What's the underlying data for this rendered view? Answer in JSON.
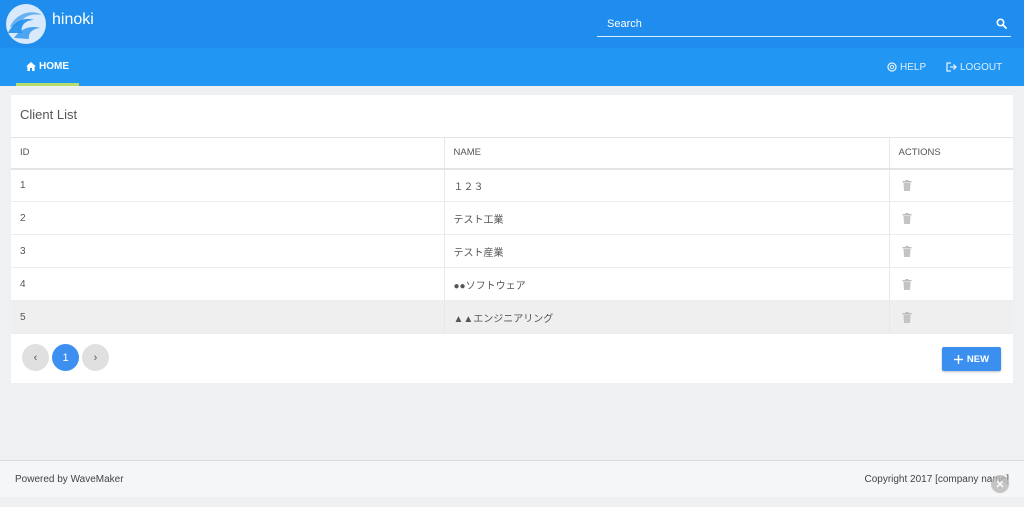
{
  "header": {
    "app_name": "hinoki",
    "search": {
      "placeholder": "Search",
      "value": ""
    }
  },
  "nav": {
    "home_label": "HOME",
    "help_label": "HELP",
    "logout_label": "LOGOUT"
  },
  "client_list": {
    "title": "Client List",
    "columns": [
      "ID",
      "NAME",
      "ACTIONS"
    ],
    "rows": [
      {
        "id": "1",
        "name": "１２３"
      },
      {
        "id": "2",
        "name": "テスト工業"
      },
      {
        "id": "3",
        "name": "テスト産業"
      },
      {
        "id": "4",
        "name": "●●ソフトウェア"
      },
      {
        "id": "5",
        "name": "▲▲エンジニアリング"
      }
    ],
    "pagination": {
      "prev": "‹",
      "current": "1",
      "next": "›"
    },
    "new_button_label": "NEW"
  },
  "footer": {
    "left": "Powered by WaveMaker",
    "right": "Copyright 2017 [company name]"
  },
  "icons": {
    "logo": "wave-logo-icon",
    "search": "search-icon",
    "home": "home-icon",
    "help": "help-icon",
    "logout": "logout-icon",
    "delete": "trash-icon",
    "add": "plus-icon"
  },
  "colors": {
    "topbar": "#1e8ded",
    "navbar": "#2196f3",
    "active_tab_underline": "#b6dc6a",
    "primary_button": "#3a8fef"
  }
}
